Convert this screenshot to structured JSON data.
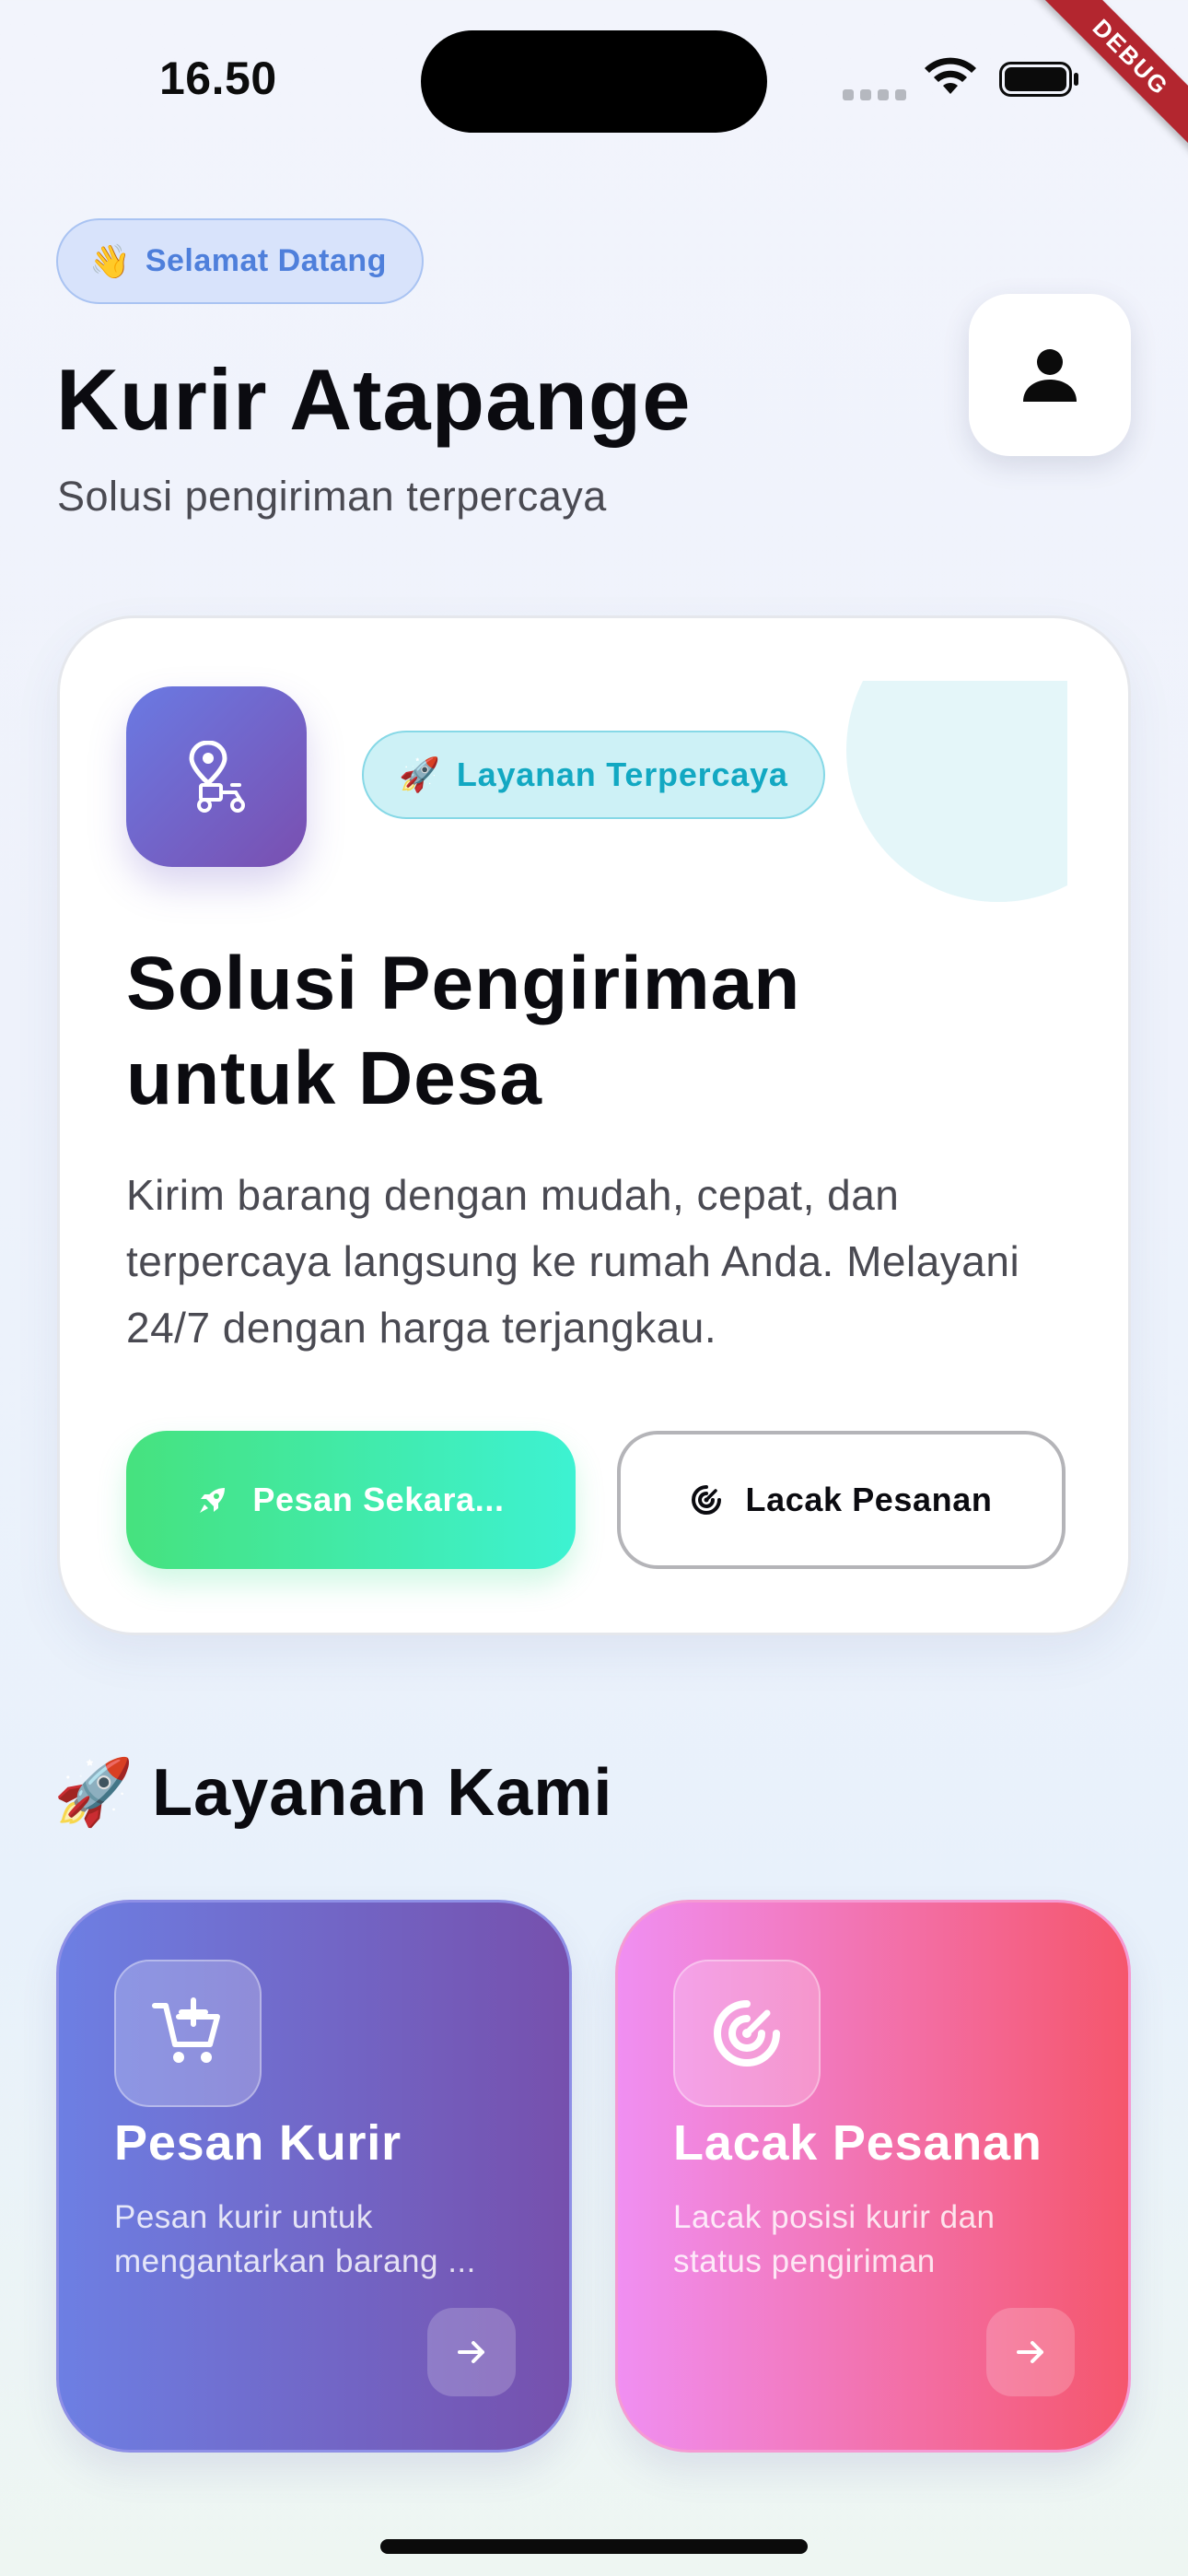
{
  "status_bar": {
    "time": "16.50",
    "debug_label": "DEBUG"
  },
  "header": {
    "welcome_emoji": "👋",
    "welcome_text": "Selamat Datang",
    "title": "Kurir Atapange",
    "subtitle": "Solusi pengiriman terpercaya",
    "profile_icon": "person-icon"
  },
  "hero": {
    "icon": "courier-scooter-icon",
    "badge_emoji": "🚀",
    "badge_text": "Layanan Terpercaya",
    "heading_line1": "Solusi Pengiriman",
    "heading_line2": "untuk Desa",
    "description": "Kirim barang dengan mudah, cepat, dan terpercaya langsung ke rumah Anda. Melayani 24/7 dengan harga terjangkau.",
    "primary_button": "Pesan Sekara...",
    "secondary_button": "Lacak Pesanan"
  },
  "services": {
    "section_emoji": "🚀",
    "section_title": "Layanan Kami",
    "items": [
      {
        "title": "Pesan Kurir",
        "desc_line1": "Pesan kurir untuk",
        "desc_line2": "mengantarkan barang ...",
        "icon": "add-cart-icon"
      },
      {
        "title": "Lacak Pesanan",
        "desc_line1": "Lacak posisi kurir dan",
        "desc_line2": "status pengiriman",
        "icon": "track-radar-icon"
      }
    ]
  },
  "colors": {
    "order_gradient": [
      "#6d7fe3",
      "#7650ad"
    ],
    "track_gradient": [
      "#f08ff2",
      "#f5566c"
    ],
    "primary_button_gradient": [
      "#46e27e",
      "#3df2d2"
    ],
    "accent_blue": "#4e7fdb",
    "accent_cyan": "#12a8c2"
  }
}
